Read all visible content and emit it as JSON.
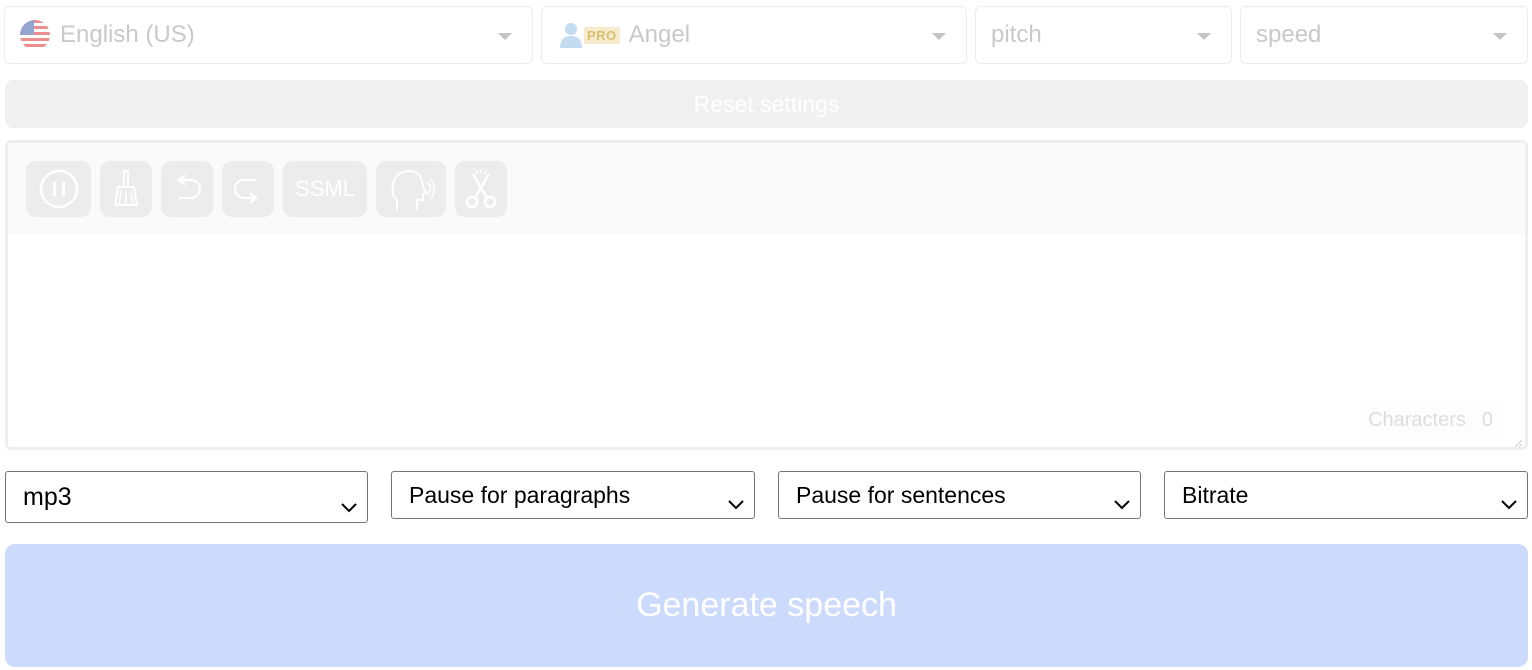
{
  "language_select": {
    "value": "English (US)",
    "flag_icon": "us-flag-icon"
  },
  "voice_select": {
    "badge": "PRO",
    "value": "Angel",
    "icon": "user-icon"
  },
  "pitch_select": {
    "value": "pitch"
  },
  "speed_select": {
    "value": "speed"
  },
  "reset_button": {
    "label": "Reset settings"
  },
  "toolbar": {
    "buttons": [
      {
        "name": "pause",
        "icon": "pause-circle-icon"
      },
      {
        "name": "clear",
        "icon": "broom-icon"
      },
      {
        "name": "undo",
        "icon": "undo-arrow-icon"
      },
      {
        "name": "redo",
        "icon": "redo-arrow-icon"
      },
      {
        "name": "ssml",
        "label": "SSML"
      },
      {
        "name": "voice-preview",
        "icon": "speaking-head-icon"
      },
      {
        "name": "cut",
        "icon": "scissors-icon"
      }
    ]
  },
  "editor": {
    "text": "",
    "characters_label": "Characters",
    "characters_count": "0"
  },
  "format_select": {
    "value": "mp3"
  },
  "paragraph_pause_select": {
    "value": "Pause for paragraphs"
  },
  "sentence_pause_select": {
    "value": "Pause for sentences"
  },
  "bitrate_select": {
    "value": "Bitrate"
  },
  "generate_button": {
    "label": "Generate speech"
  },
  "colors": {
    "generate_bg": "#ccdafb",
    "disabled_text": "#c9c9c9",
    "pro_badge_bg": "#f6eccb"
  }
}
